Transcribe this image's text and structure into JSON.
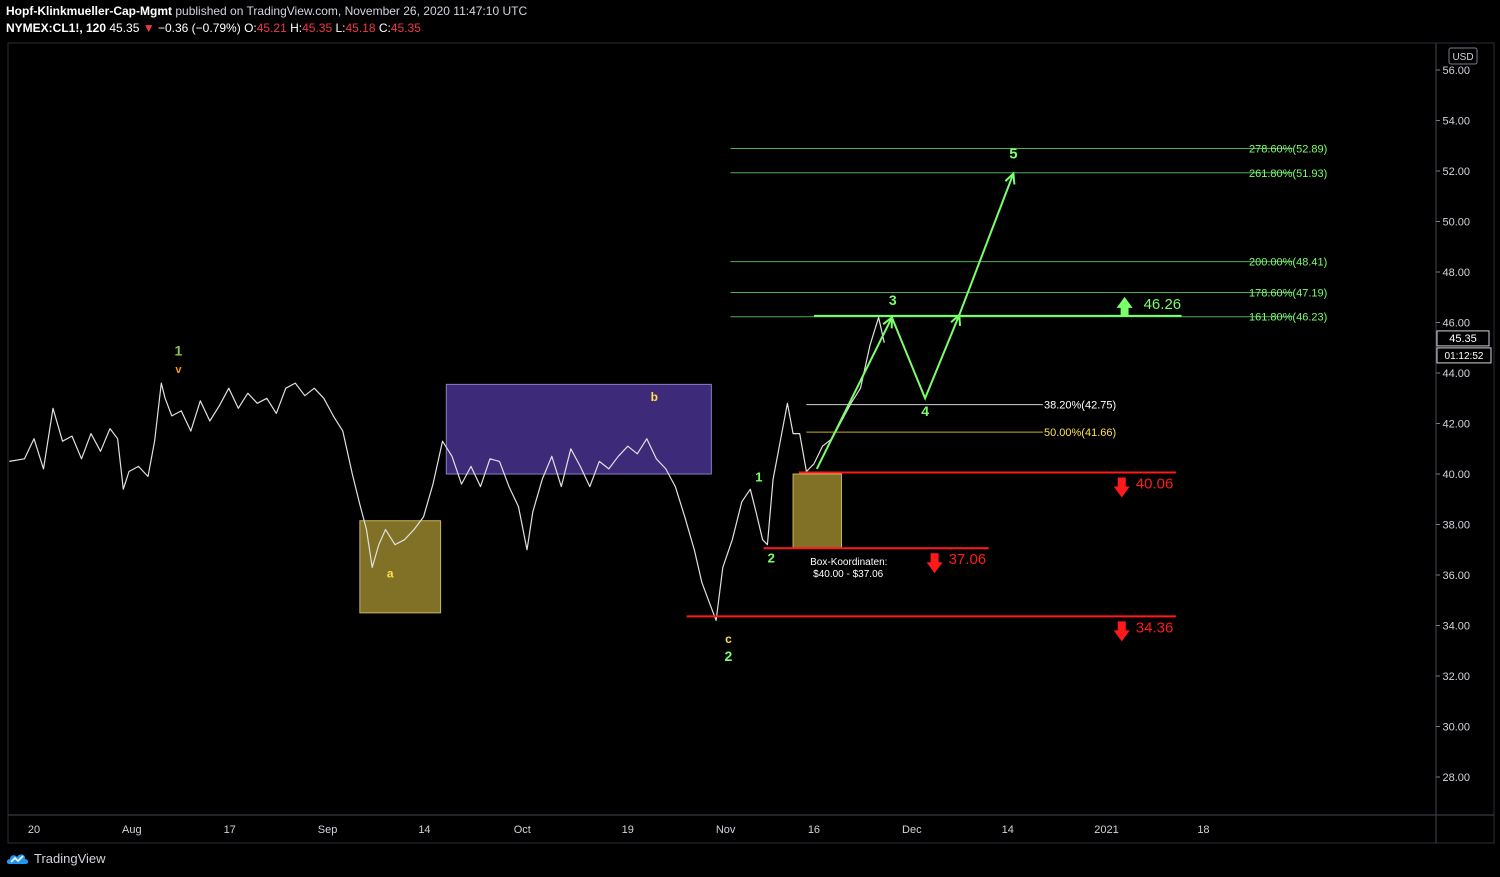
{
  "header": {
    "author": "Hopf-Klinkmueller-Cap-Mgmt",
    "published": "published on TradingView.com, November 26, 2020 11:47:10 UTC",
    "symbol": "NYMEX:CL1!, 120",
    "last": "45.35",
    "change": "−0.36 (−0.79%)",
    "open_label": "O:",
    "open": "45.21",
    "high_label": "H:",
    "high": "45.35",
    "low_label": "L:",
    "low": "45.18",
    "close_label": "C:",
    "close": "45.35"
  },
  "footer": {
    "brand": "TradingView"
  },
  "colors": {
    "background": "#000000",
    "price": "#e0e0e0",
    "fib_green": "#4caf50",
    "target_green": "#7bff6b",
    "stop_red": "#ff1a1a",
    "yellow": "#ffe04b",
    "purple_box": "#3d2b7a",
    "olive_box": "#807127"
  },
  "chart_data": {
    "type": "line",
    "currency": "USD",
    "y_ticks": [
      "56.00",
      "54.00",
      "52.00",
      "50.00",
      "48.00",
      "46.00",
      "44.00",
      "42.00",
      "40.00",
      "38.00",
      "36.00",
      "34.00",
      "32.00",
      "30.00",
      "28.00"
    ],
    "ylim": [
      26.8,
      56.6
    ],
    "x_ticks": [
      {
        "label": "20",
        "t": 0
      },
      {
        "label": "Aug",
        "t": 10.3
      },
      {
        "label": "17",
        "t": 20.6
      },
      {
        "label": "Sep",
        "t": 30.9
      },
      {
        "label": "14",
        "t": 41.1
      },
      {
        "label": "Oct",
        "t": 51.4
      },
      {
        "label": "19",
        "t": 62.5
      },
      {
        "label": "Nov",
        "t": 72.8
      },
      {
        "label": "16",
        "t": 82.1
      },
      {
        "label": "Dec",
        "t": 92.4
      },
      {
        "label": "14",
        "t": 102.5
      },
      {
        "label": "2021",
        "t": 112.9
      },
      {
        "label": "18",
        "t": 123.1
      }
    ],
    "price_path": [
      [
        -2.6,
        40.5
      ],
      [
        -1,
        40.6
      ],
      [
        0,
        41.4
      ],
      [
        1,
        40.2
      ],
      [
        2,
        42.6
      ],
      [
        3,
        41.3
      ],
      [
        4,
        41.5
      ],
      [
        5,
        40.6
      ],
      [
        6,
        41.6
      ],
      [
        7,
        40.9
      ],
      [
        8,
        41.8
      ],
      [
        8.8,
        41.4
      ],
      [
        9.4,
        39.4
      ],
      [
        10,
        40.1
      ],
      [
        11,
        40.3
      ],
      [
        12,
        39.9
      ],
      [
        12.7,
        41.3
      ],
      [
        13.4,
        43.6
      ],
      [
        13.8,
        43.0
      ],
      [
        14.5,
        42.3
      ],
      [
        15.5,
        42.5
      ],
      [
        16.5,
        41.7
      ],
      [
        17.5,
        42.9
      ],
      [
        18.5,
        42.1
      ],
      [
        19.5,
        42.7
      ],
      [
        20.5,
        43.4
      ],
      [
        21.5,
        42.6
      ],
      [
        22.5,
        43.2
      ],
      [
        23.5,
        42.8
      ],
      [
        24.5,
        43.0
      ],
      [
        25.5,
        42.4
      ],
      [
        26.5,
        43.4
      ],
      [
        27.5,
        43.6
      ],
      [
        28.5,
        43.1
      ],
      [
        29.5,
        43.4
      ],
      [
        30.5,
        43.0
      ],
      [
        31.5,
        42.3
      ],
      [
        32.5,
        41.7
      ],
      [
        33.5,
        40.0
      ],
      [
        34.3,
        38.8
      ],
      [
        35,
        37.8
      ],
      [
        35.6,
        36.3
      ],
      [
        36.3,
        37.2
      ],
      [
        37,
        37.8
      ],
      [
        38,
        37.2
      ],
      [
        39,
        37.4
      ],
      [
        40,
        37.8
      ],
      [
        41,
        38.3
      ],
      [
        42,
        39.6
      ],
      [
        43,
        41.3
      ],
      [
        44,
        40.7
      ],
      [
        45,
        39.6
      ],
      [
        46,
        40.3
      ],
      [
        47,
        39.5
      ],
      [
        48,
        40.6
      ],
      [
        49,
        40.5
      ],
      [
        50,
        39.5
      ],
      [
        51,
        38.7
      ],
      [
        51.9,
        37.0
      ],
      [
        52.5,
        38.5
      ],
      [
        53.5,
        39.8
      ],
      [
        54.5,
        40.7
      ],
      [
        55.5,
        39.5
      ],
      [
        56.5,
        41.0
      ],
      [
        57.5,
        40.3
      ],
      [
        58.5,
        39.5
      ],
      [
        59.5,
        40.5
      ],
      [
        60.5,
        40.2
      ],
      [
        61.5,
        40.7
      ],
      [
        62.5,
        41.1
      ],
      [
        63.5,
        40.8
      ],
      [
        64.5,
        41.4
      ],
      [
        65.5,
        40.6
      ],
      [
        66.5,
        40.2
      ],
      [
        67.5,
        39.5
      ],
      [
        68.5,
        38.3
      ],
      [
        69.5,
        37.0
      ],
      [
        70.3,
        35.7
      ],
      [
        71,
        35.0
      ],
      [
        71.8,
        34.2
      ],
      [
        72.5,
        36.3
      ],
      [
        73.5,
        37.4
      ],
      [
        74.5,
        38.9
      ],
      [
        75.4,
        39.4
      ],
      [
        76,
        38.5
      ],
      [
        76.7,
        37.4
      ],
      [
        77.2,
        37.2
      ],
      [
        77.8,
        39.8
      ],
      [
        78.5,
        41.2
      ],
      [
        79.3,
        42.8
      ],
      [
        79.9,
        41.6
      ],
      [
        80.6,
        41.6
      ],
      [
        81.3,
        40.1
      ],
      [
        82.1,
        40.4
      ],
      [
        83,
        41.1
      ],
      [
        84,
        41.4
      ],
      [
        85,
        42.1
      ],
      [
        86,
        42.8
      ],
      [
        87,
        43.4
      ],
      [
        88,
        45.1
      ],
      [
        88.9,
        46.2
      ],
      [
        89.5,
        45.2
      ]
    ],
    "fib_levels": [
      {
        "label": "278.60%(52.89)",
        "value": 52.89,
        "x0": 73.3,
        "x1": 132.5,
        "color": "#4caf50"
      },
      {
        "label": "261.80%(51.93)",
        "value": 51.93,
        "x0": 73.3,
        "x1": 132.5,
        "color": "#4caf50"
      },
      {
        "label": "200.00%(48.41)",
        "value": 48.41,
        "x0": 73.3,
        "x1": 132.5,
        "color": "#4caf50"
      },
      {
        "label": "178.60%(47.19)",
        "value": 47.19,
        "x0": 73.3,
        "x1": 132.5,
        "color": "#4caf50"
      },
      {
        "label": "161.80%(46.23)",
        "value": 46.23,
        "x0": 73.3,
        "x1": 132.5,
        "color": "#4caf50"
      },
      {
        "label": "38.20%(42.75)",
        "value": 42.75,
        "x0": 81.3,
        "x1": 106.2,
        "color": "#d1d4dc"
      },
      {
        "label": "50.00%(41.66)",
        "value": 41.66,
        "x0": 81.3,
        "x1": 106.2,
        "color": "#c9b400"
      }
    ],
    "levels": [
      {
        "label": "46.26",
        "value": 46.26,
        "x0": 82.1,
        "x1": 120.8,
        "dir": "up",
        "color": "#7bff6b",
        "ax": 114.8
      },
      {
        "label": "40.06",
        "value": 40.06,
        "x0": 80.5,
        "x1": 120.2,
        "dir": "down",
        "color": "#ff1a1a",
        "ax": 114.5
      },
      {
        "label": "37.06",
        "value": 37.06,
        "x0": 76.8,
        "x1": 100.5,
        "dir": "down",
        "color": "#ff1a1a",
        "ax": 94.8
      },
      {
        "label": "34.36",
        "value": 34.36,
        "x0": 68.7,
        "x1": 120.2,
        "dir": "down",
        "color": "#ff1a1a",
        "ax": 114.5
      }
    ],
    "boxes": [
      {
        "name": "purple",
        "t0": 43.4,
        "t1": 71.3,
        "v0": 40.0,
        "v1": 43.55,
        "fill": "#3d2b7a",
        "stroke": "#8e7cc3"
      },
      {
        "name": "olive-a",
        "t0": 34.3,
        "t1": 42.8,
        "v0": 34.5,
        "v1": 38.15,
        "fill": "#807127",
        "stroke": "#c8b560"
      },
      {
        "name": "olive-target",
        "t0": 79.9,
        "t1": 85.0,
        "v0": 37.06,
        "v1": 40.0,
        "fill": "#807127",
        "stroke": "#c8b560"
      }
    ],
    "projection": [
      [
        82.4,
        40.2
      ],
      [
        90.3,
        46.2
      ],
      [
        93.8,
        43.0
      ],
      [
        97.4,
        46.3
      ],
      [
        103.1,
        51.9
      ]
    ],
    "wave_labels": [
      {
        "text": "1",
        "t": 15.2,
        "v": 44.7,
        "color": "#8bc34a",
        "size": 14
      },
      {
        "text": "v",
        "t": 15.2,
        "v": 44.0,
        "color": "#ff9800",
        "size": 11
      },
      {
        "text": "a",
        "t": 37.5,
        "v": 35.9,
        "color": "#ffe04b",
        "size": 12
      },
      {
        "text": "b",
        "t": 65.3,
        "v": 42.9,
        "color": "#ffe04b",
        "size": 12
      },
      {
        "text": "c",
        "t": 73.1,
        "v": 33.3,
        "color": "#ffe04b",
        "size": 12
      },
      {
        "text": "2",
        "t": 73.1,
        "v": 32.6,
        "color": "#7bff6b",
        "size": 14
      },
      {
        "text": "1",
        "t": 76.3,
        "v": 39.7,
        "color": "#7bff6b",
        "size": 13
      },
      {
        "text": "2",
        "t": 77.6,
        "v": 36.5,
        "color": "#7bff6b",
        "size": 13
      },
      {
        "text": "3",
        "t": 90.4,
        "v": 46.7,
        "color": "#7bff6b",
        "size": 14
      },
      {
        "text": "4",
        "t": 93.8,
        "v": 42.3,
        "color": "#7bff6b",
        "size": 14
      },
      {
        "text": "5",
        "t": 103.1,
        "v": 52.5,
        "color": "#7bff6b",
        "size": 15
      }
    ],
    "box_note": {
      "line1": "Box-Koordinaten:",
      "line2": "$40.00 - $37.06",
      "t": 81.7,
      "v": 36.4
    },
    "price_badge": {
      "value": "45.35",
      "countdown": "01:12:52"
    }
  }
}
